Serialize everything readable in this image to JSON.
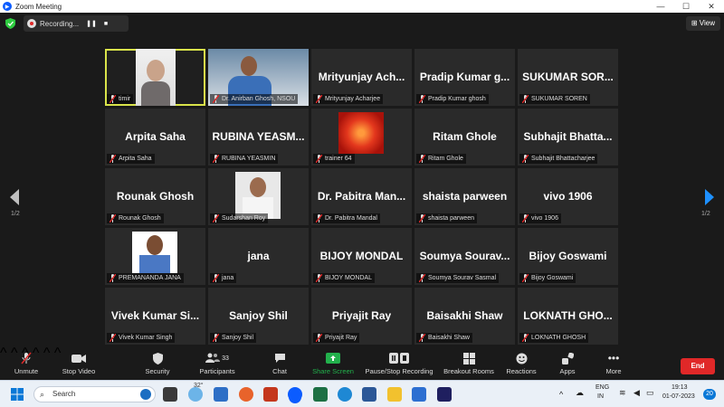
{
  "window": {
    "title": "Zoom Meeting",
    "controls": [
      "—",
      "☐",
      "✕"
    ]
  },
  "meeting": {
    "recording_label": "Recording...",
    "view_label": "View"
  },
  "tiles": [
    {
      "big": "",
      "label": "timir",
      "kind": "video-timir",
      "active": true
    },
    {
      "big": "",
      "label": "Dr. Anirban Ghosh, NSOU",
      "kind": "video-anirban"
    },
    {
      "big": "Mrityunjay Ach...",
      "label": "Mrityunjay Acharjee"
    },
    {
      "big": "Pradip Kumar g...",
      "label": "Pradip Kumar ghosh"
    },
    {
      "big": "SUKUMAR SOR...",
      "label": "SUKUMAR SOREN"
    },
    {
      "big": "Arpita Saha",
      "label": "Arpita Saha"
    },
    {
      "big": "RUBINA YEASM...",
      "label": "RUBINA YEASMIN"
    },
    {
      "big": "",
      "label": "trainer 64",
      "kind": "flower"
    },
    {
      "big": "Ritam Ghole",
      "label": "Ritam Ghole"
    },
    {
      "big": "Subhajit Bhatta...",
      "label": "Subhajit Bhattacharjee"
    },
    {
      "big": "Rounak Ghosh",
      "label": "Rounak Ghosh"
    },
    {
      "big": "",
      "label": "Sudarshan Roy",
      "kind": "photo-sudarshan"
    },
    {
      "big": "Dr. Pabitra Man...",
      "label": "Dr. Pabitra Mandal"
    },
    {
      "big": "shaista parween",
      "label": "shaista parween"
    },
    {
      "big": "vivo 1906",
      "label": "vivo 1906"
    },
    {
      "big": "",
      "label": "PREMANANDA JANA",
      "kind": "photo-premananda"
    },
    {
      "big": "jana",
      "label": "jana"
    },
    {
      "big": "BIJOY MONDAL",
      "label": "BIJOY MONDAL"
    },
    {
      "big": "Soumya Sourav...",
      "label": "Soumya Sourav Sasmal"
    },
    {
      "big": "Bijoy Goswami",
      "label": "Bijoy Goswami"
    },
    {
      "big": "Vivek Kumar Si...",
      "label": "Vivek Kumar Singh"
    },
    {
      "big": "Sanjoy Shil",
      "label": "Sanjoy Shil"
    },
    {
      "big": "Priyajit Ray",
      "label": "Priyajit Ray"
    },
    {
      "big": "Baisakhi Shaw",
      "label": "Baisakhi Shaw"
    },
    {
      "big": "LOKNATH GHO...",
      "label": "LOKNATH GHOSH"
    }
  ],
  "pagination": {
    "left": "1/2",
    "right": "1/2"
  },
  "toolbar": {
    "unmute": "Unmute",
    "stop_video": "Stop Video",
    "security": "Security",
    "participants": "Participants",
    "participants_count": "33",
    "chat": "Chat",
    "share_screen": "Share Screen",
    "recording": "Pause/Stop Recording",
    "breakout": "Breakout Rooms",
    "reactions": "Reactions",
    "apps": "Apps",
    "more": "More",
    "end": "End"
  },
  "taskbar": {
    "search_placeholder": "Search",
    "weather_temp": "32°",
    "lang1": "ENG",
    "lang2": "IN",
    "time": "19:13",
    "date": "01-07-2023",
    "notif_count": "20"
  },
  "colors": {
    "active_border": "#d9e34a",
    "end_button": "#e02828",
    "share_green": "#22b14c",
    "accent_blue": "#0b5cff"
  }
}
